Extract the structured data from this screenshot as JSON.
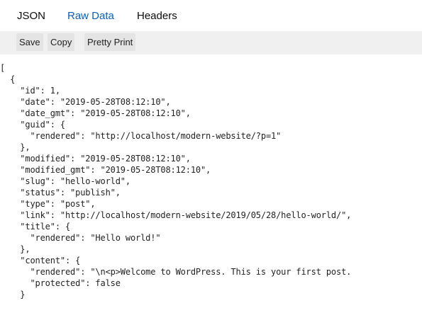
{
  "tabs": [
    {
      "label": "JSON",
      "active": false
    },
    {
      "label": "Raw Data",
      "active": true
    },
    {
      "label": "Headers",
      "active": false
    }
  ],
  "toolbar": {
    "save_label": "Save",
    "copy_label": "Copy",
    "pretty_print_label": "Pretty Print"
  },
  "colors": {
    "active_tab": "#0a5fbf",
    "toolbar_background": "#f0f0f0",
    "text": "#222222"
  },
  "raw_lines": [
    "[",
    "  {",
    "    \"id\": 1,",
    "    \"date\": \"2019-05-28T08:12:10\",",
    "    \"date_gmt\": \"2019-05-28T08:12:10\",",
    "    \"guid\": {",
    "      \"rendered\": \"http://localhost/modern-website/?p=1\"",
    "    },",
    "    \"modified\": \"2019-05-28T08:12:10\",",
    "    \"modified_gmt\": \"2019-05-28T08:12:10\",",
    "    \"slug\": \"hello-world\",",
    "    \"status\": \"publish\",",
    "    \"type\": \"post\",",
    "    \"link\": \"http://localhost/modern-website/2019/05/28/hello-world/\",",
    "    \"title\": {",
    "      \"rendered\": \"Hello world!\"",
    "    },",
    "    \"content\": {",
    "      \"rendered\": \"\\n<p>Welcome to WordPress. This is your first post.",
    "      \"protected\": false",
    "    }"
  ]
}
